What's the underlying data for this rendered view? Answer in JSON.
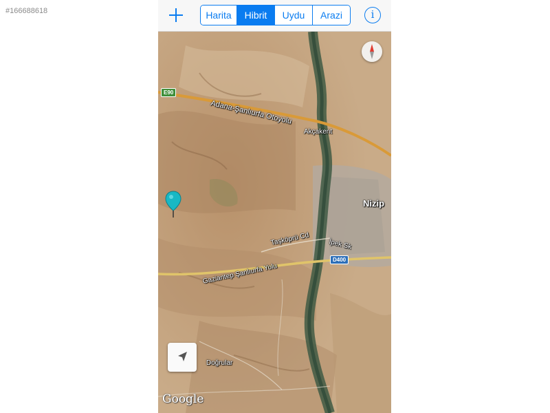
{
  "listing_id": "#166688618",
  "toolbar": {
    "add_icon": "plus-icon",
    "map_types": [
      {
        "label": "Harita",
        "active": false
      },
      {
        "label": "Hibrit",
        "active": true
      },
      {
        "label": "Uydu",
        "active": false
      },
      {
        "label": "Arazi",
        "active": false
      }
    ],
    "info_label": "i",
    "accent_color": "#0a7cf0"
  },
  "map": {
    "labels": {
      "highway": "Adana-Şanlıurfa Otoyolu",
      "akcakent": "Akçakent",
      "nizip": "Nizip",
      "taskopru": "Taşköprü Cd",
      "ipek": "İpek Sk",
      "gaziantep_road": "Gaziantep Şanlıurfa Yolu",
      "dogrular": "Doğrular"
    },
    "road_badges": {
      "e90": "E90",
      "d400": "D400"
    },
    "attribution": "Google",
    "pin_color": "#19b8c4",
    "compass_icon": "compass-icon",
    "locate_icon": "location-arrow-icon"
  }
}
